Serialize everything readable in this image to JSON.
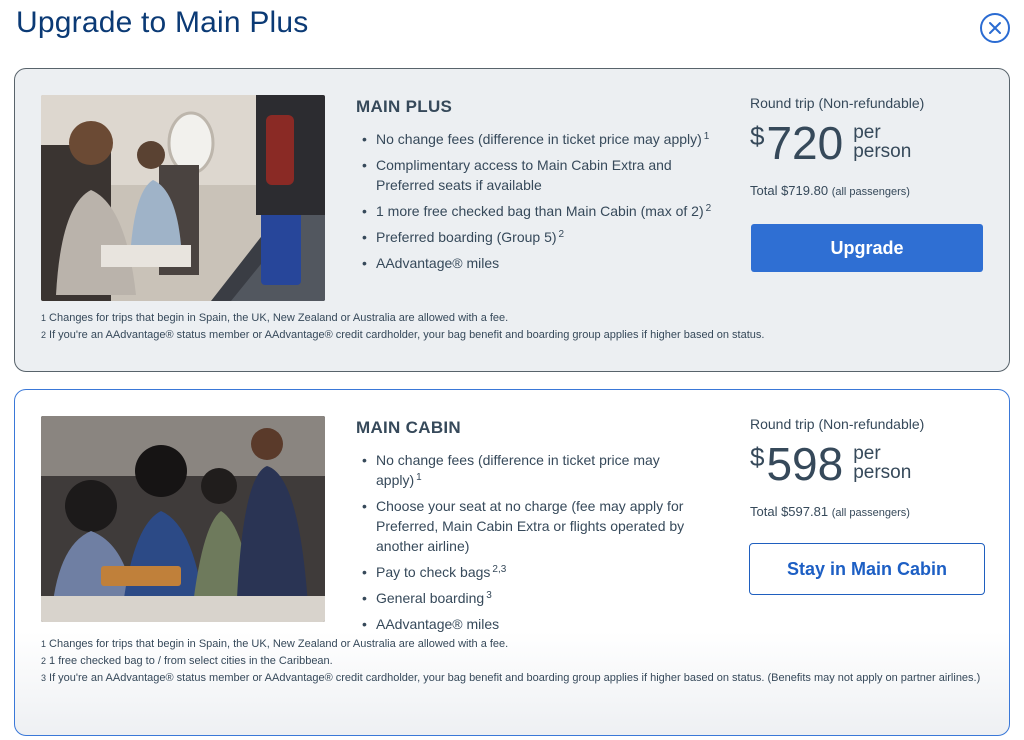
{
  "modal": {
    "title": "Upgrade to Main Plus"
  },
  "icons": {
    "close": "close-circle-icon"
  },
  "colors": {
    "primary": "#2f6fd3",
    "title": "#0b3a75",
    "text": "#36495a"
  },
  "main_plus": {
    "name": "MAIN PLUS",
    "benefits": [
      {
        "text": "No change fees (difference in ticket price may apply)",
        "sup": "1"
      },
      {
        "text": "Complimentary access to Main Cabin Extra and Preferred seats if available",
        "sup": ""
      },
      {
        "text": "1 more free checked bag than Main Cabin (max of 2)",
        "sup": "2"
      },
      {
        "text": "Preferred boarding (Group 5)",
        "sup": "2"
      },
      {
        "text": "AAdvantage® miles",
        "sup": ""
      }
    ],
    "trip_type": "Round trip (Non-refundable)",
    "currency": "$",
    "price": "720",
    "per_person": "per person",
    "total": "Total $719.80",
    "total_note": "(all passengers)",
    "button": "Upgrade",
    "footnotes": [
      {
        "num": "1",
        "text": "Changes for trips that begin in Spain, the UK, New Zealand or Australia are allowed with a fee."
      },
      {
        "num": "2",
        "text": "If you're an AAdvantage® status member or AAdvantage® credit cardholder, your bag benefit and boarding group applies if higher based on status."
      }
    ]
  },
  "main_cabin": {
    "name": "MAIN CABIN",
    "benefits": [
      {
        "text": "No change fees (difference in ticket price may apply)",
        "sup": "1"
      },
      {
        "text": "Choose your seat at no charge (fee may apply for Preferred, Main Cabin Extra or flights operated by another airline)",
        "sup": ""
      },
      {
        "text": "Pay to check bags",
        "sup": "2,3"
      },
      {
        "text": "General boarding",
        "sup": "3"
      },
      {
        "text": "AAdvantage® miles",
        "sup": ""
      }
    ],
    "trip_type": "Round trip (Non-refundable)",
    "currency": "$",
    "price": "598",
    "per_person": "per person",
    "total": "Total $597.81",
    "total_note": "(all passengers)",
    "button": "Stay in Main Cabin",
    "footnotes": [
      {
        "num": "1",
        "text": "Changes for trips that begin in Spain, the UK, New Zealand or Australia are allowed with a fee."
      },
      {
        "num": "2",
        "text": "1 free checked bag to / from select cities in the Caribbean."
      },
      {
        "num": "3",
        "text": "If you're an AAdvantage® status member or AAdvantage® credit cardholder, your bag benefit and boarding group applies if higher based on status. (Benefits may not apply on partner airlines.)"
      }
    ]
  }
}
